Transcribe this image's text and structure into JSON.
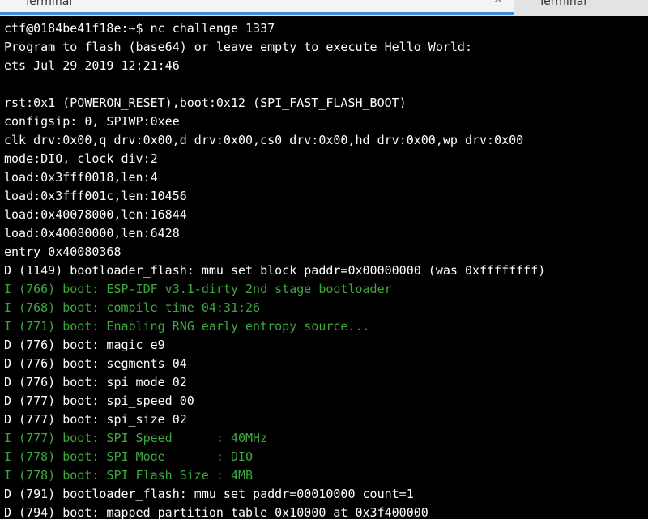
{
  "colors": {
    "default_text": "#ffffff",
    "green_text": "#3ea83e",
    "background": "#000000"
  },
  "tabs": [
    {
      "label": "Terminal",
      "active": true,
      "close_icon": "close-icon"
    },
    {
      "label": "Terminal",
      "active": false
    }
  ],
  "terminal": {
    "lines": [
      {
        "text": "ctf@0184be41f18e:~$ nc challenge 1337",
        "color": "default"
      },
      {
        "text": "Program to flash (base64) or leave empty to execute Hello World:",
        "color": "default"
      },
      {
        "text": "ets Jul 29 2019 12:21:46",
        "color": "default"
      },
      {
        "text": "",
        "color": "default"
      },
      {
        "text": "rst:0x1 (POWERON_RESET),boot:0x12 (SPI_FAST_FLASH_BOOT)",
        "color": "default"
      },
      {
        "text": "configsip: 0, SPIWP:0xee",
        "color": "default"
      },
      {
        "text": "clk_drv:0x00,q_drv:0x00,d_drv:0x00,cs0_drv:0x00,hd_drv:0x00,wp_drv:0x00",
        "color": "default"
      },
      {
        "text": "mode:DIO, clock div:2",
        "color": "default"
      },
      {
        "text": "load:0x3fff0018,len:4",
        "color": "default"
      },
      {
        "text": "load:0x3fff001c,len:10456",
        "color": "default"
      },
      {
        "text": "load:0x40078000,len:16844",
        "color": "default"
      },
      {
        "text": "load:0x40080000,len:6428",
        "color": "default"
      },
      {
        "text": "entry 0x40080368",
        "color": "default"
      },
      {
        "text": "D (1149) bootloader_flash: mmu set block paddr=0x00000000 (was 0xffffffff)",
        "color": "default"
      },
      {
        "text": "I (766) boot: ESP-IDF v3.1-dirty 2nd stage bootloader",
        "color": "green"
      },
      {
        "text": "I (768) boot: compile time 04:31:26",
        "color": "green"
      },
      {
        "text": "I (771) boot: Enabling RNG early entropy source...",
        "color": "green"
      },
      {
        "text": "D (776) boot: magic e9",
        "color": "default"
      },
      {
        "text": "D (776) boot: segments 04",
        "color": "default"
      },
      {
        "text": "D (776) boot: spi_mode 02",
        "color": "default"
      },
      {
        "text": "D (777) boot: spi_speed 00",
        "color": "default"
      },
      {
        "text": "D (777) boot: spi_size 02",
        "color": "default"
      },
      {
        "text": "I (777) boot: SPI Speed      : 40MHz",
        "color": "green"
      },
      {
        "text": "I (778) boot: SPI Mode       : DIO",
        "color": "green"
      },
      {
        "text": "I (778) boot: SPI Flash Size : 4MB",
        "color": "green"
      },
      {
        "text": "D (791) bootloader_flash: mmu set paddr=00010000 count=1",
        "color": "default"
      },
      {
        "text": "D (794) boot: mapped partition table 0x10000 at 0x3f400000",
        "color": "default"
      }
    ]
  }
}
